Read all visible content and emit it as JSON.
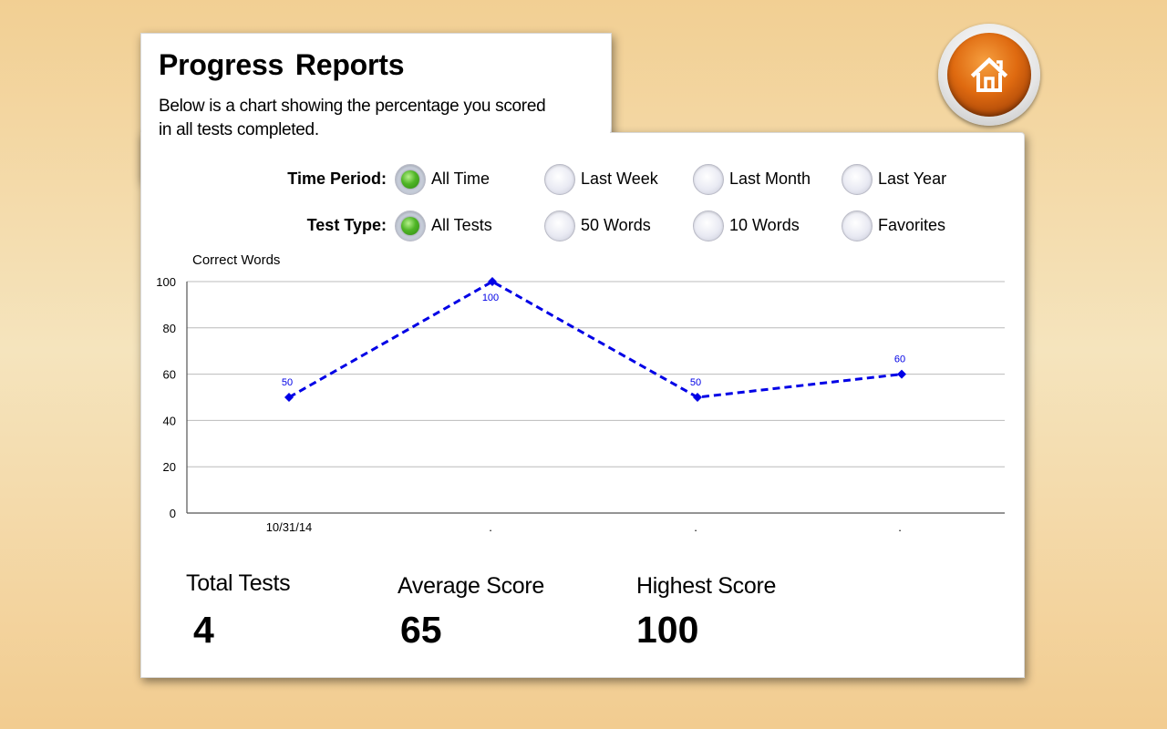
{
  "header": {
    "title": "Progress  Reports",
    "subtitle": "Below is a chart showing the percentage you scored in all tests completed."
  },
  "filters": {
    "time_period": {
      "label": "Time Period:",
      "options": [
        "All Time",
        "Last Week",
        "Last Month",
        "Last Year"
      ],
      "selected": "All Time"
    },
    "test_type": {
      "label": "Test Type:",
      "options": [
        "All Tests",
        "50 Words",
        "10 Words",
        "Favorites"
      ],
      "selected": "All Tests"
    }
  },
  "home_button": {
    "icon": "home-icon"
  },
  "chart_data": {
    "type": "line",
    "ylabel": "Correct Words",
    "categories": [
      "10/31/14",
      ".",
      ".",
      "."
    ],
    "series": [
      {
        "values": [
          50,
          100,
          50,
          60
        ],
        "color": "#0000e6"
      }
    ],
    "ylim": [
      0,
      100
    ],
    "yticks": [
      0,
      20,
      40,
      60,
      80,
      100
    ],
    "grid": true
  },
  "stats": {
    "total_tests": {
      "label": "Total Tests",
      "value": "4"
    },
    "average_score": {
      "label": "Average Score",
      "value": "65"
    },
    "highest_score": {
      "label": "Highest Score",
      "value": "100"
    }
  },
  "colors": {
    "background": "#f2cf93",
    "accent_orange": "#df6a10",
    "selected_radio": "#4fb526",
    "series_line": "#0000e6"
  }
}
